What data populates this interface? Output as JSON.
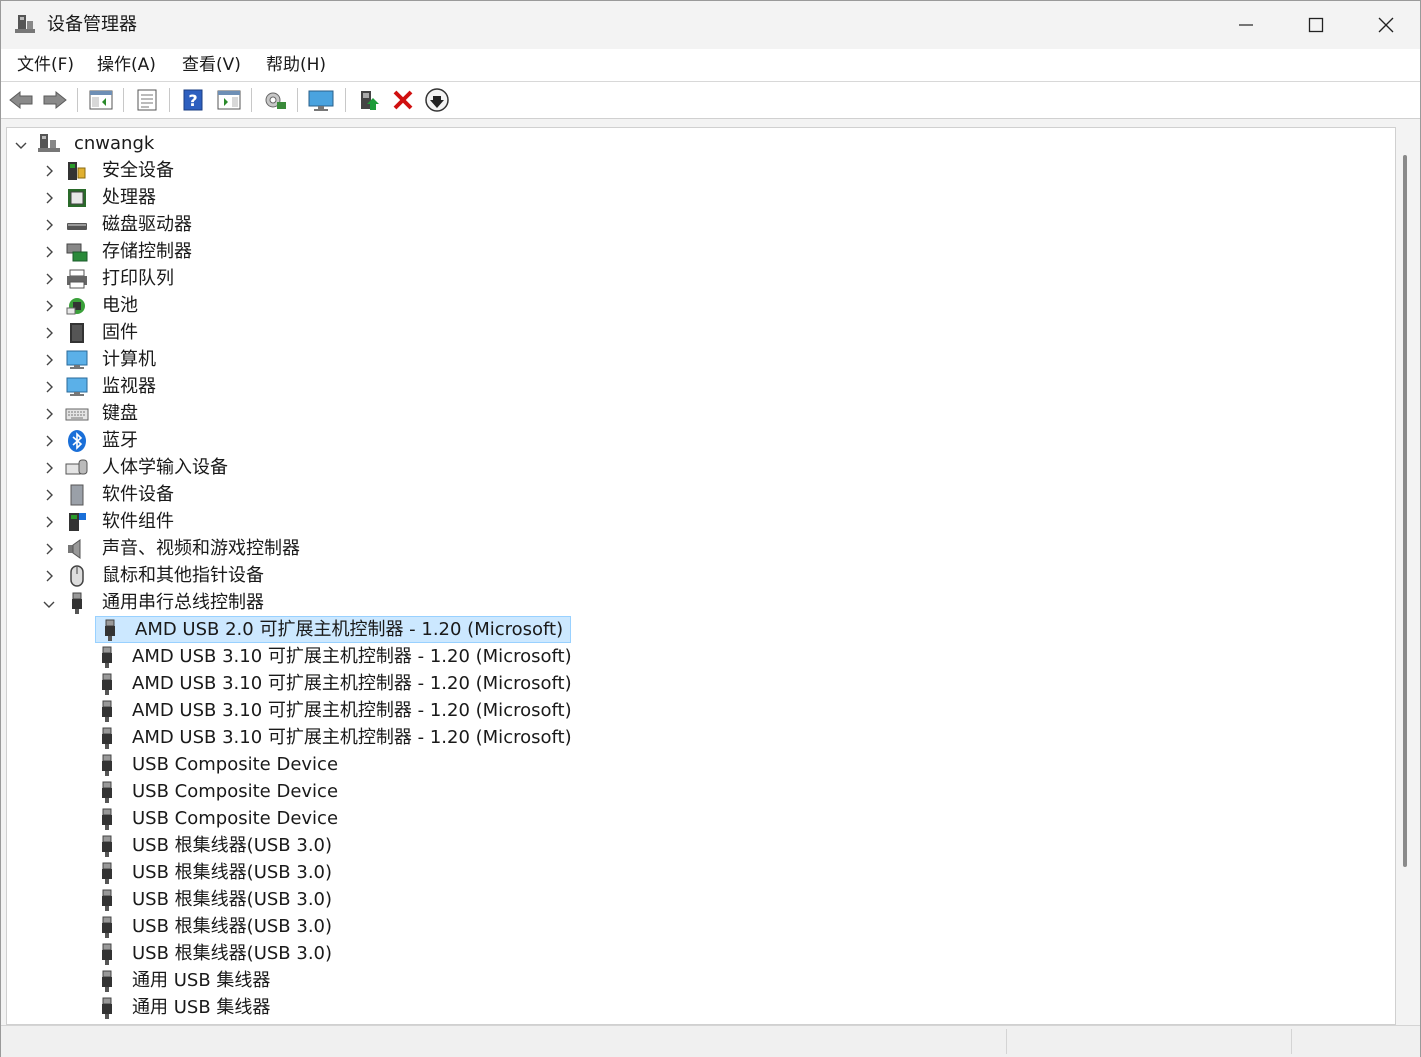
{
  "window": {
    "title": "设备管理器",
    "icon": "device-manager-icon"
  },
  "menu": {
    "file": "文件(F)",
    "action": "操作(A)",
    "view": "查看(V)",
    "help": "帮助(H)"
  },
  "toolbar": {
    "buttons": [
      "back-arrow-icon",
      "forward-arrow-icon",
      "show-hide-console-tree-icon",
      "properties-icon",
      "help-icon",
      "action-pane-icon",
      "scan-hardware-icon",
      "monitor-icon",
      "update-driver-icon",
      "uninstall-icon",
      "disable-device-icon"
    ],
    "accent_red": "#d01010",
    "accent_green": "#1e9c3a"
  },
  "tree": {
    "root": "cnwangk",
    "categories": [
      "安全设备",
      "处理器",
      "磁盘驱动器",
      "存储控制器",
      "打印队列",
      "电池",
      "固件",
      "计算机",
      "监视器",
      "键盘",
      "蓝牙",
      "人体学输入设备",
      "软件设备",
      "软件组件",
      "声音、视频和游戏控制器",
      "鼠标和其他指针设备",
      "通用串行总线控制器"
    ],
    "usb_children": [
      "AMD USB 2.0 可扩展主机控制器 - 1.20 (Microsoft)",
      "AMD USB 3.10 可扩展主机控制器 - 1.20 (Microsoft)",
      "AMD USB 3.10 可扩展主机控制器 - 1.20 (Microsoft)",
      "AMD USB 3.10 可扩展主机控制器 - 1.20 (Microsoft)",
      "AMD USB 3.10 可扩展主机控制器 - 1.20 (Microsoft)",
      "USB Composite Device",
      "USB Composite Device",
      "USB Composite Device",
      "USB 根集线器(USB 3.0)",
      "USB 根集线器(USB 3.0)",
      "USB 根集线器(USB 3.0)",
      "USB 根集线器(USB 3.0)",
      "USB 根集线器(USB 3.0)",
      "通用 USB 集线器",
      "通用 USB 集线器"
    ],
    "selected_child_index": 0,
    "selection_color": "#cce8ff"
  }
}
